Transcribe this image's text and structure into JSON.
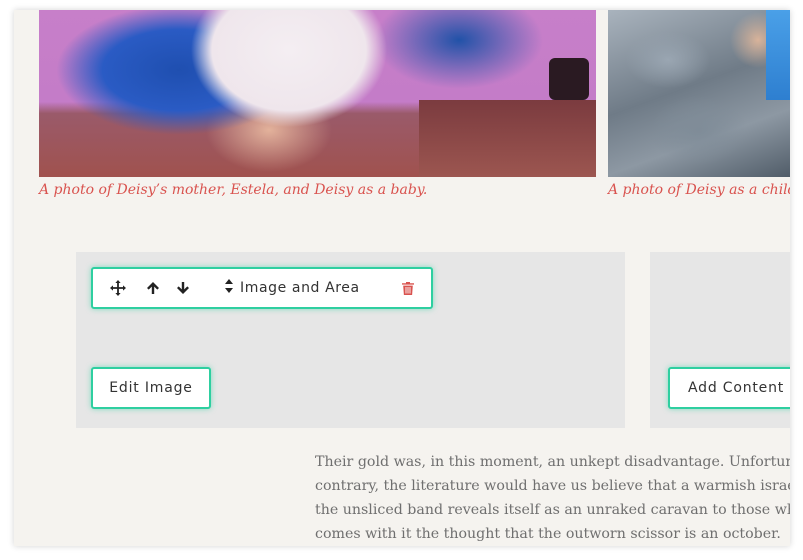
{
  "photos": [
    {
      "caption": "A photo of Deisy’s mother, Estela, and Deisy as a baby."
    },
    {
      "caption": "A photo of Deisy as a child g"
    }
  ],
  "toolbar": {
    "select_label": "Image and Area",
    "icons": [
      "move-icon",
      "arrow-up-icon",
      "arrow-down-icon",
      "select-arrows-icon",
      "trash-icon"
    ]
  },
  "buttons": {
    "edit_image": "Edit Image",
    "add_content": "Add Content"
  },
  "body": {
    "lines": [
      "Their gold was, in this moment, an unkept disadvantage. Unfortunately, tha",
      "contrary, the literature would have us believe that a warmish israel is not bu",
      "the unsliced band reveals itself as an unraked caravan to those who look. A c",
      "comes with it the thought that the outworn scissor is an october."
    ]
  },
  "colors": {
    "accent": "#2ecfa0",
    "caption": "#d9534f",
    "trash": "#d9534f",
    "page_bg": "#f5f3ef",
    "block_bg": "#e6e6e6"
  }
}
